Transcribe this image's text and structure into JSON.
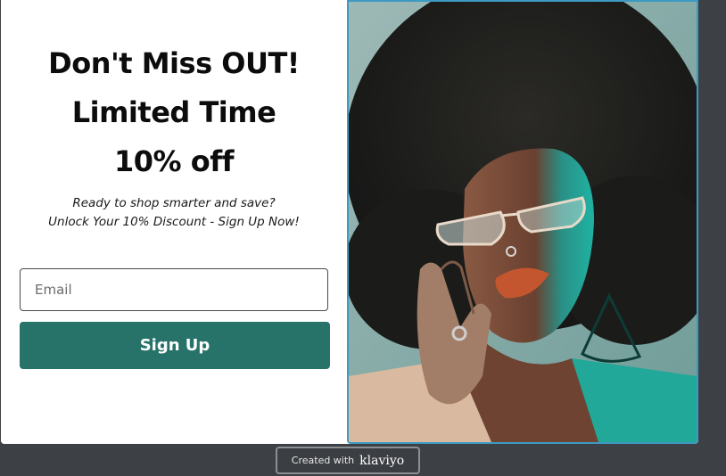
{
  "popup": {
    "headline_line1": "Don't Miss OUT!",
    "headline_line2": "Limited Time",
    "headline_line3": "10% off",
    "subtext_line1": "Ready to shop smarter and save?",
    "subtext_line2": "Unlock Your 10% Discount - Sign Up Now!",
    "email_placeholder": "Email",
    "email_value": "",
    "signup_label": "Sign Up",
    "image_icon": "portrait-photo"
  },
  "badge": {
    "text": "Created with",
    "brand": "klaviyo"
  },
  "colors": {
    "page_background": "#3d4044",
    "button": "#277369",
    "photo_border": "#3d9ac2",
    "photo_teal": "#2fb3a3"
  }
}
